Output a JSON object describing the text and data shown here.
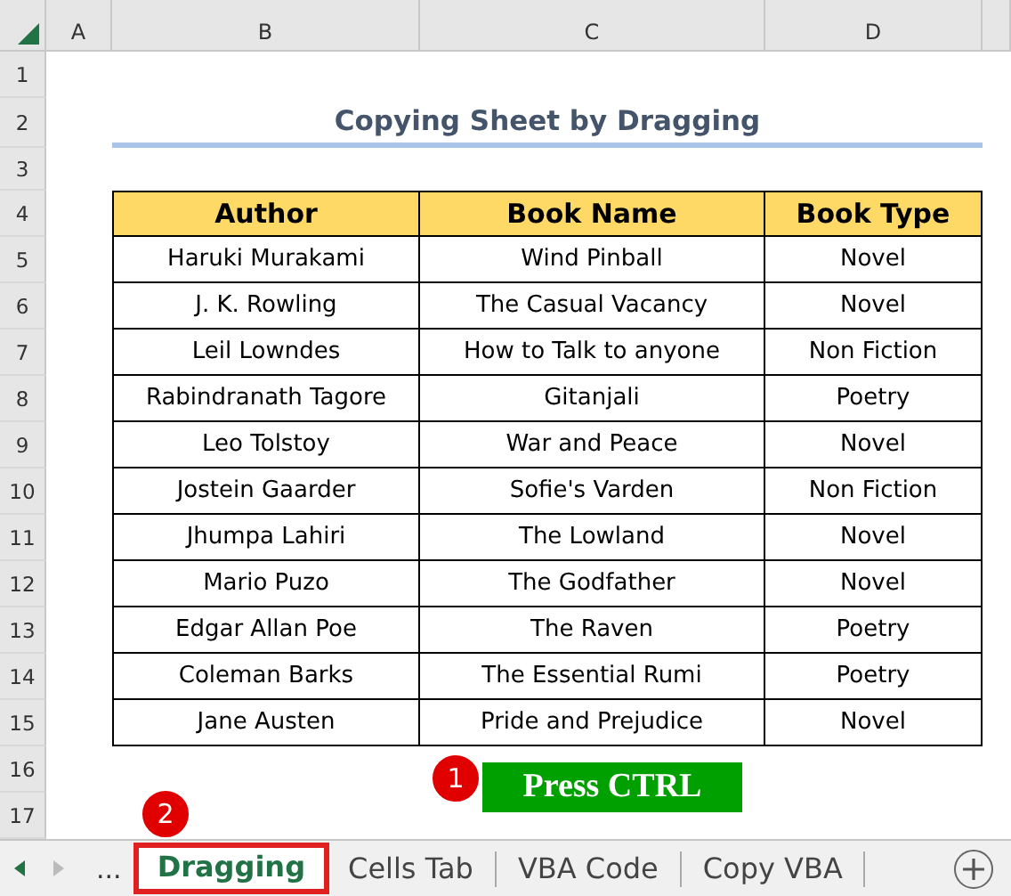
{
  "column_headers": [
    "A",
    "B",
    "C",
    "D"
  ],
  "row_headers": [
    "1",
    "2",
    "3",
    "4",
    "5",
    "6",
    "7",
    "8",
    "9",
    "10",
    "11",
    "12",
    "13",
    "14",
    "15",
    "16",
    "17"
  ],
  "title": "Copying Sheet by Dragging",
  "table": {
    "columns": [
      "Author",
      "Book Name",
      "Book Type"
    ],
    "rows": [
      [
        "Haruki Murakami",
        "Wind Pinball",
        "Novel"
      ],
      [
        "J. K. Rowling",
        "The Casual Vacancy",
        "Novel"
      ],
      [
        "Leil Lowndes",
        "How to Talk to anyone",
        "Non Fiction"
      ],
      [
        "Rabindranath Tagore",
        "Gitanjali",
        "Poetry"
      ],
      [
        "Leo Tolstoy",
        "War and Peace",
        "Novel"
      ],
      [
        "Jostein Gaarder",
        "Sofie's Varden",
        "Non Fiction"
      ],
      [
        "Jhumpa Lahiri",
        "The Lowland",
        "Novel"
      ],
      [
        "Mario Puzo",
        "The Godfather",
        "Novel"
      ],
      [
        "Edgar Allan Poe",
        "The Raven",
        "Poetry"
      ],
      [
        "Coleman Barks",
        "The Essential Rumi",
        "Poetry"
      ],
      [
        "Jane Austen",
        "Pride and Prejudice",
        "Novel"
      ]
    ]
  },
  "callouts": [
    {
      "number": "1",
      "label": "Press CTRL"
    },
    {
      "number": "2"
    }
  ],
  "sheet_tabs": {
    "overflow": "...",
    "tabs": [
      {
        "label": "Dragging",
        "selected": true
      },
      {
        "label": "Cells Tab",
        "selected": false
      },
      {
        "label": "VBA Code",
        "selected": false
      },
      {
        "label": "Copy VBA",
        "selected": false
      }
    ]
  }
}
